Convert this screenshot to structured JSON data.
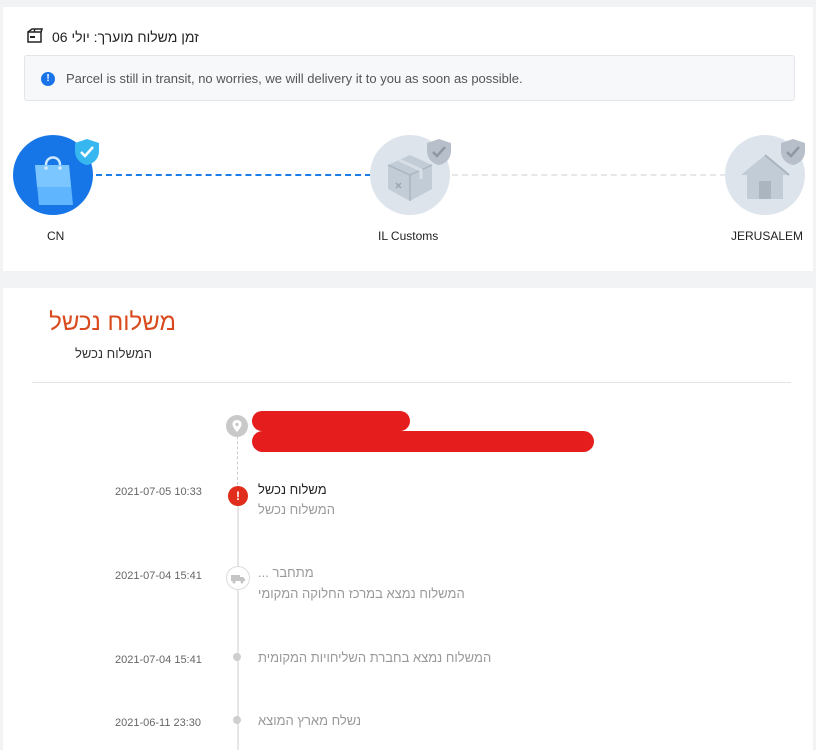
{
  "header": {
    "eta_text": "זמן משלוח מוערך: יולי 06",
    "eta_icon": "delivery-box-icon"
  },
  "notice": {
    "icon": "info-icon",
    "text": "Parcel is still in transit, no worries, we will delivery it to you as soon as possible."
  },
  "route": {
    "stops": [
      {
        "label": "CN",
        "icon": "shopping-bag-icon",
        "state": "done"
      },
      {
        "label": "IL Customs",
        "icon": "package-icon",
        "state": "pending"
      },
      {
        "label": "JERUSALEM",
        "icon": "house-icon",
        "state": "pending"
      }
    ],
    "colors": {
      "active": "#1676e8",
      "pending": "#dde4ec",
      "check_active": "#37b7f0",
      "check_pending": "#b7c0ca"
    }
  },
  "status": {
    "title": "משלוח נכשל",
    "subtitle": "המשלוח נכשל",
    "title_color": "#d94a1e"
  },
  "timeline": {
    "destination_icon": "location-pin-icon",
    "events": [
      {
        "time": "2021-07-05 10:33",
        "title": "משלוח נכשל",
        "desc": "המשלוח נכשל",
        "icon": "alert-icon"
      },
      {
        "time": "2021-07-04 15:41",
        "title": "מתחבר ...",
        "desc": "המשלוח נמצא במרכז החלוקה המקומי",
        "icon": "truck-icon"
      },
      {
        "time": "2021-07-04 15:41",
        "title": "המשלוח נמצא בחברת השליחויות המקומית",
        "desc": "",
        "icon": "dot"
      },
      {
        "time": "2021-06-11 23:30",
        "title": "נשלח מארץ המוצא",
        "desc": "",
        "icon": "dot"
      }
    ]
  }
}
